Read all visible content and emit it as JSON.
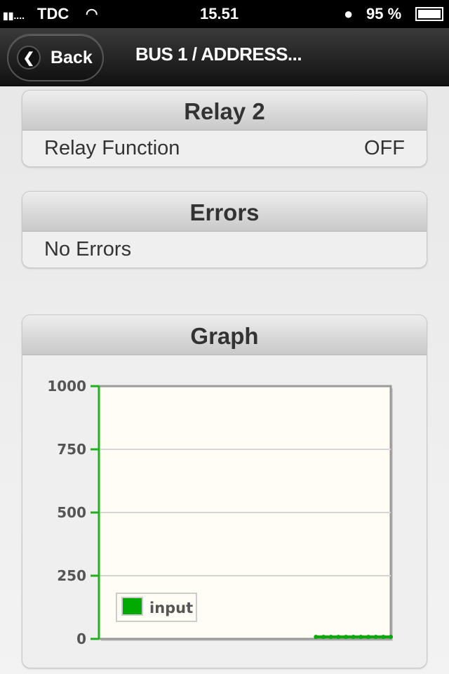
{
  "status_bar": {
    "carrier": "TDC",
    "time": "15.51",
    "battery": "95 %",
    "icons": [
      "signal-icon",
      "wifi-icon",
      "clock-icon",
      "battery-icon"
    ]
  },
  "nav": {
    "back_label": "Back",
    "title": "BUS 1 / ADDRESS..."
  },
  "relay": {
    "title": "Relay 2",
    "label": "Relay Function",
    "value": "OFF"
  },
  "errors": {
    "title": "Errors",
    "text": "No Errors"
  },
  "graph": {
    "title": "Graph"
  },
  "chart_data": {
    "type": "line",
    "ylim": [
      0,
      1000
    ],
    "yticks": [
      "0",
      "250",
      "500",
      "750",
      "1000"
    ],
    "grid": true,
    "legend_position": "bottom-left",
    "series": [
      {
        "name": "input",
        "color": "#00aa00",
        "x": [
          29,
          30,
          31,
          32,
          33,
          34,
          35,
          36,
          37,
          38,
          39
        ],
        "values": [
          8,
          8,
          8,
          8,
          8,
          8,
          8,
          8,
          8,
          8,
          8
        ]
      }
    ],
    "xlim": [
      0,
      39
    ]
  }
}
